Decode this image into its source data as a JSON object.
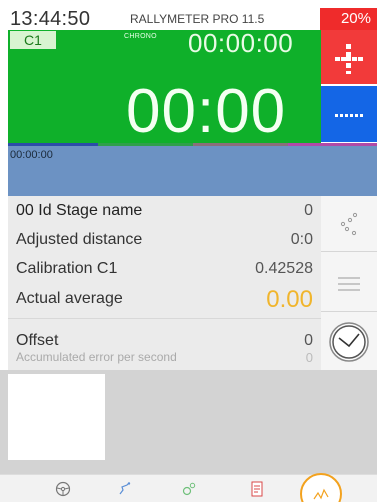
{
  "header": {
    "clock": "13:44:50",
    "app_title": "RALLYMETER PRO 11.5",
    "battery": "20%"
  },
  "chrono": {
    "counter_badge": "C1",
    "label": "CHRONO",
    "time_small": "00:00:00",
    "time_big": "00:00"
  },
  "graph": {
    "time": "00:00:00"
  },
  "info": {
    "stage_label": "00 Id Stage name",
    "stage_value": "0",
    "adjusted_distance_label": "Adjusted distance",
    "adjusted_distance_value": "0:0",
    "calibration_label": "Calibration C1",
    "calibration_value": "0.42528",
    "actual_average_label": "Actual average",
    "actual_average_value": "0.00",
    "offset_label": "Offset",
    "offset_value": "0",
    "accumulated_error_label": "Accumulated error per second",
    "accumulated_error_value": "0"
  },
  "colors": {
    "chrono_green": "#0fb02a",
    "battery_red": "#ef2b2b",
    "action_red": "#f23a3a",
    "action_blue": "#1466e6",
    "graph_blue": "#6c92c3",
    "average_yellow": "#f0b52d",
    "active_tab_orange": "#f3a21e"
  },
  "side_buttons": [
    "dots-icon",
    "menu-lines-icon",
    "clock-icon"
  ],
  "tabs": [
    "steering-wheel-icon",
    "route-icon",
    "gear-icon",
    "document-icon",
    "graph-icon"
  ]
}
